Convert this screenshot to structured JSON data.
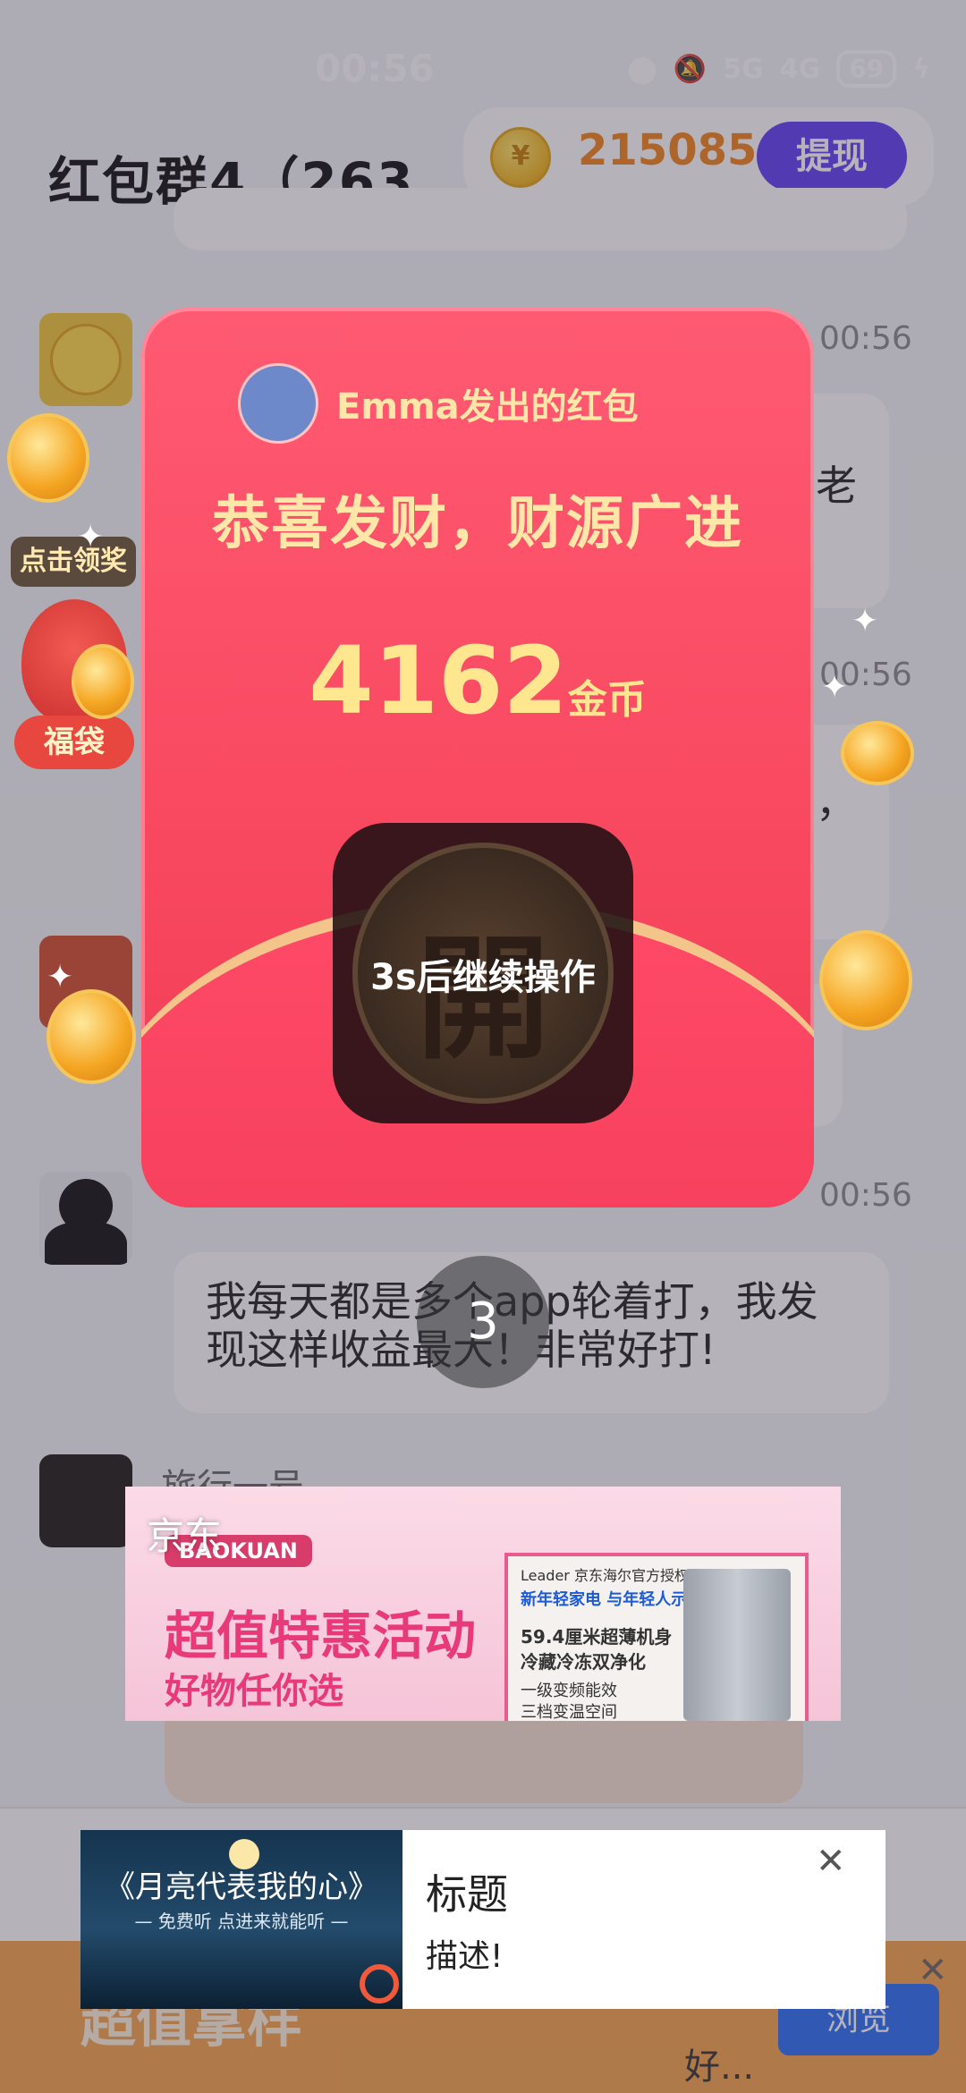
{
  "status_bar": {
    "time": "00:56",
    "network1": "5G",
    "network2": "4G",
    "battery": "69"
  },
  "header": {
    "title": "红包群4（263...",
    "coin_amount": "215085",
    "withdraw_label": "提现"
  },
  "chat": {
    "timestamps": [
      "00:56",
      "00:56",
      "00:56"
    ],
    "fragment_a": "老",
    "fragment_b": "，",
    "sender_last": "旅行一号",
    "message": "我每天都是多个app轮着打，我发现这样收益最大！非常好打!"
  },
  "lucky_bag": {
    "tag": "点击领奖",
    "pill": "福袋"
  },
  "envelope": {
    "sender": "Emma发出的红包",
    "wish": "恭喜发财，财源广进",
    "amount": "4162",
    "unit": "金币",
    "open_glyph": "開",
    "wait_label": "3s后继续操作"
  },
  "countdown": "3",
  "jd_ad": {
    "source": "京东",
    "brand": "BAOKUAN",
    "headline": "超值特惠活动",
    "subline": "好物任你选",
    "product_lines": [
      "Leader  京东海尔官方授权",
      "新年轻家电 与年轻人示唱",
      "59.4厘米超薄机身",
      "冷藏冷冻双净化",
      "一级变频能效",
      "三档变温空间"
    ]
  },
  "bottom_ad": {
    "thumb_title": "《月亮代表我的心》",
    "thumb_sub": "— 免费听 点进来就能听 —",
    "title": "标题",
    "description": "描述!"
  },
  "behind_ad": {
    "headline": "超值拿样",
    "browse": "浏览",
    "tail": "好..."
  }
}
